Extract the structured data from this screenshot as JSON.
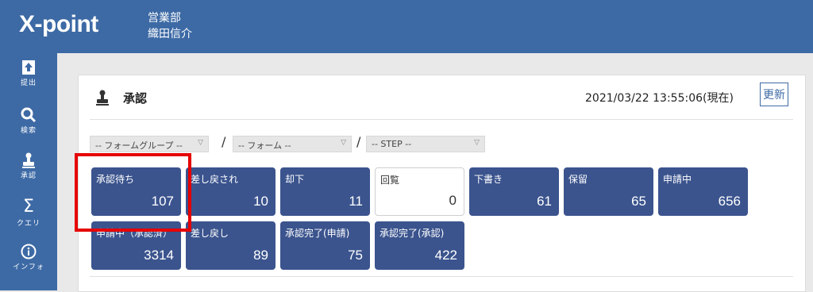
{
  "header": {
    "logo": "X-point",
    "department": "営業部",
    "user_name": "織田信介"
  },
  "sidebar": {
    "items": [
      {
        "label": "提出",
        "icon": "upload-icon"
      },
      {
        "label": "検索",
        "icon": "search-icon"
      },
      {
        "label": "承認",
        "icon": "stamp-icon"
      },
      {
        "label": "クエリ",
        "icon": "sigma-icon"
      },
      {
        "label": "インフォ",
        "icon": "info-icon"
      }
    ]
  },
  "panel": {
    "title": "承認",
    "datetime": "2021/03/22 13:55:06(現在)",
    "refresh_label": "更新",
    "filters": {
      "form_group": "-- フォームグループ --",
      "form": "-- フォーム --",
      "step": "-- STEP --",
      "separator": "/"
    },
    "tiles": [
      {
        "label": "承認待ち",
        "count": "107"
      },
      {
        "label": "差し戻され",
        "count": "10"
      },
      {
        "label": "却下",
        "count": "11"
      },
      {
        "label": "回覧",
        "count": "0"
      },
      {
        "label": "下書き",
        "count": "61"
      },
      {
        "label": "保留",
        "count": "65"
      },
      {
        "label": "申請中",
        "count": "656"
      },
      {
        "label": "申請中（承認済）",
        "count": "3314"
      },
      {
        "label": "差し戻し",
        "count": "89"
      },
      {
        "label": "承認完了(申請)",
        "count": "75"
      },
      {
        "label": "承認完了(承認)",
        "count": "422"
      }
    ]
  },
  "colors": {
    "header": "#3d6aa5",
    "tile": "#3b548e",
    "highlight": "#e60000"
  }
}
